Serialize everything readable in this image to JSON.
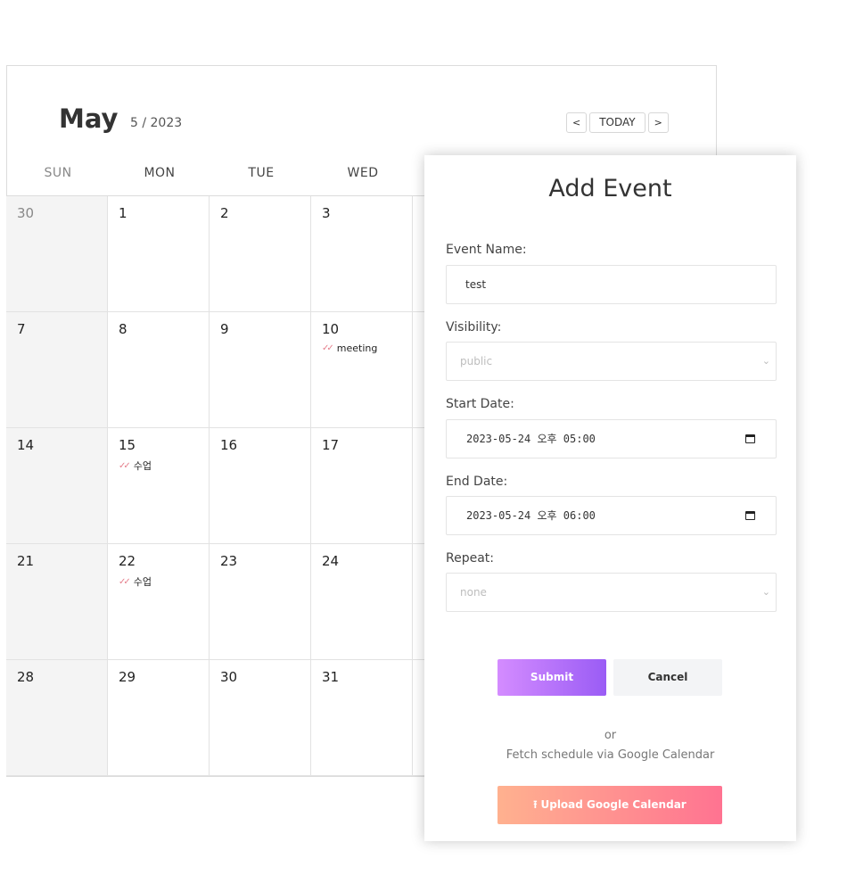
{
  "calendar": {
    "month": "May",
    "month_sub": "5 / 2023",
    "nav": {
      "prev": "<",
      "today": "TODAY",
      "next": ">"
    },
    "weekdays": [
      "SUN",
      "MON",
      "TUE",
      "WED"
    ],
    "weeks": [
      [
        {
          "day": "30",
          "other": true
        },
        {
          "day": "1"
        },
        {
          "day": "2"
        },
        {
          "day": "3"
        }
      ],
      [
        {
          "day": "7"
        },
        {
          "day": "8"
        },
        {
          "day": "9"
        },
        {
          "day": "10",
          "event": "meeting"
        }
      ],
      [
        {
          "day": "14"
        },
        {
          "day": "15",
          "event": "수업"
        },
        {
          "day": "16"
        },
        {
          "day": "17"
        }
      ],
      [
        {
          "day": "21"
        },
        {
          "day": "22",
          "event": "수업"
        },
        {
          "day": "23"
        },
        {
          "day": "24"
        }
      ],
      [
        {
          "day": "28"
        },
        {
          "day": "29"
        },
        {
          "day": "30"
        },
        {
          "day": "31"
        }
      ]
    ],
    "event_check_color": "#e57f8c"
  },
  "modal": {
    "title": "Add Event",
    "event_name": {
      "label": "Event Name:",
      "value": "test"
    },
    "visibility": {
      "label": "Visibility:",
      "value": "public"
    },
    "start_date": {
      "label": "Start Date:",
      "value": "2023-05-24 오후 05:00"
    },
    "end_date": {
      "label": "End Date:",
      "value": "2023-05-24 오후 06:00"
    },
    "repeat": {
      "label": "Repeat:",
      "value": "none"
    },
    "submit_label": "Submit",
    "cancel_label": "Cancel",
    "or_text": "or",
    "fetch_text": "Fetch schedule via Google Calendar",
    "upload_label": "Upload Google Calendar",
    "colors": {
      "submit_gradient": [
        "#d48cff",
        "#9a5cf5"
      ],
      "upload_gradient": [
        "#ffb18f",
        "#ff7391"
      ]
    }
  }
}
